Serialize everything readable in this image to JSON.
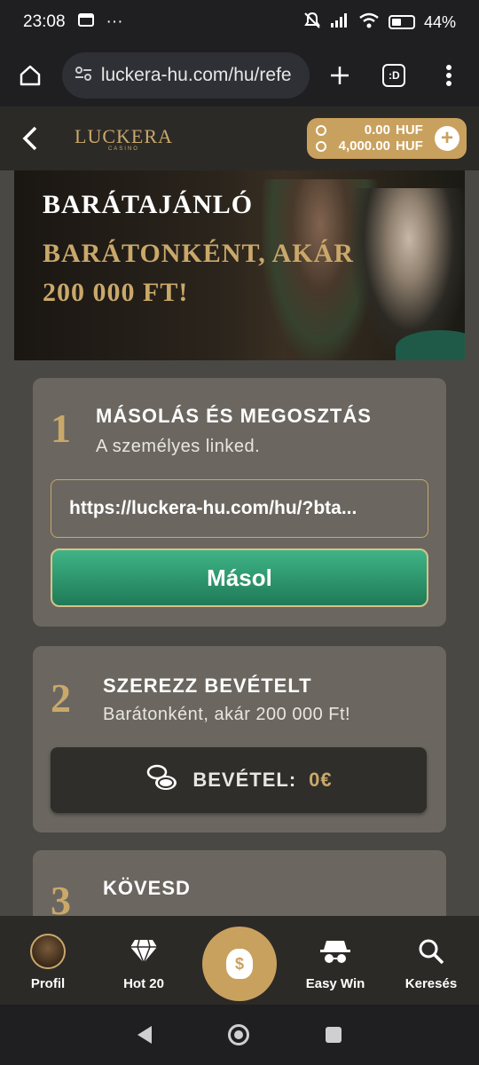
{
  "status": {
    "time": "23:08",
    "more": "···",
    "battery": "44%"
  },
  "browser": {
    "url": "luckera-hu.com/hu/refe",
    "tab_label": ":D"
  },
  "header": {
    "logo": "LUCKERA",
    "logo_sub": "CASINO",
    "balance_1_amount": "0.00",
    "balance_1_currency": "HUF",
    "balance_2_amount": "4,000.00",
    "balance_2_currency": "HUF",
    "plus": "+"
  },
  "banner": {
    "title": "BARÁTAJÁNLÓ",
    "subtitle": "BARÁTONKÉNT, AKÁR 200 000 FT!"
  },
  "steps": [
    {
      "number": "1",
      "title": "MÁSOLÁS ÉS MEGOSZTÁS",
      "desc": "A személyes linked.",
      "link": "https://luckera-hu.com/hu/?bta...",
      "button": "Másol"
    },
    {
      "number": "2",
      "title": "SZEREZZ BEVÉTELT",
      "desc": "Barátonként, akár 200 000 Ft!",
      "earn_label": "BEVÉTEL:",
      "earn_value": "0€"
    },
    {
      "number": "3",
      "title": "KÖVESD",
      "desc": ""
    }
  ],
  "nav": {
    "profile": "Profil",
    "hot": "Hot 20",
    "easy_win": "Easy Win",
    "search": "Keresés",
    "center_symbol": "$"
  },
  "colors": {
    "gold": "#c9a86a",
    "green": "#2f9a6f",
    "card": "#6b6760"
  }
}
